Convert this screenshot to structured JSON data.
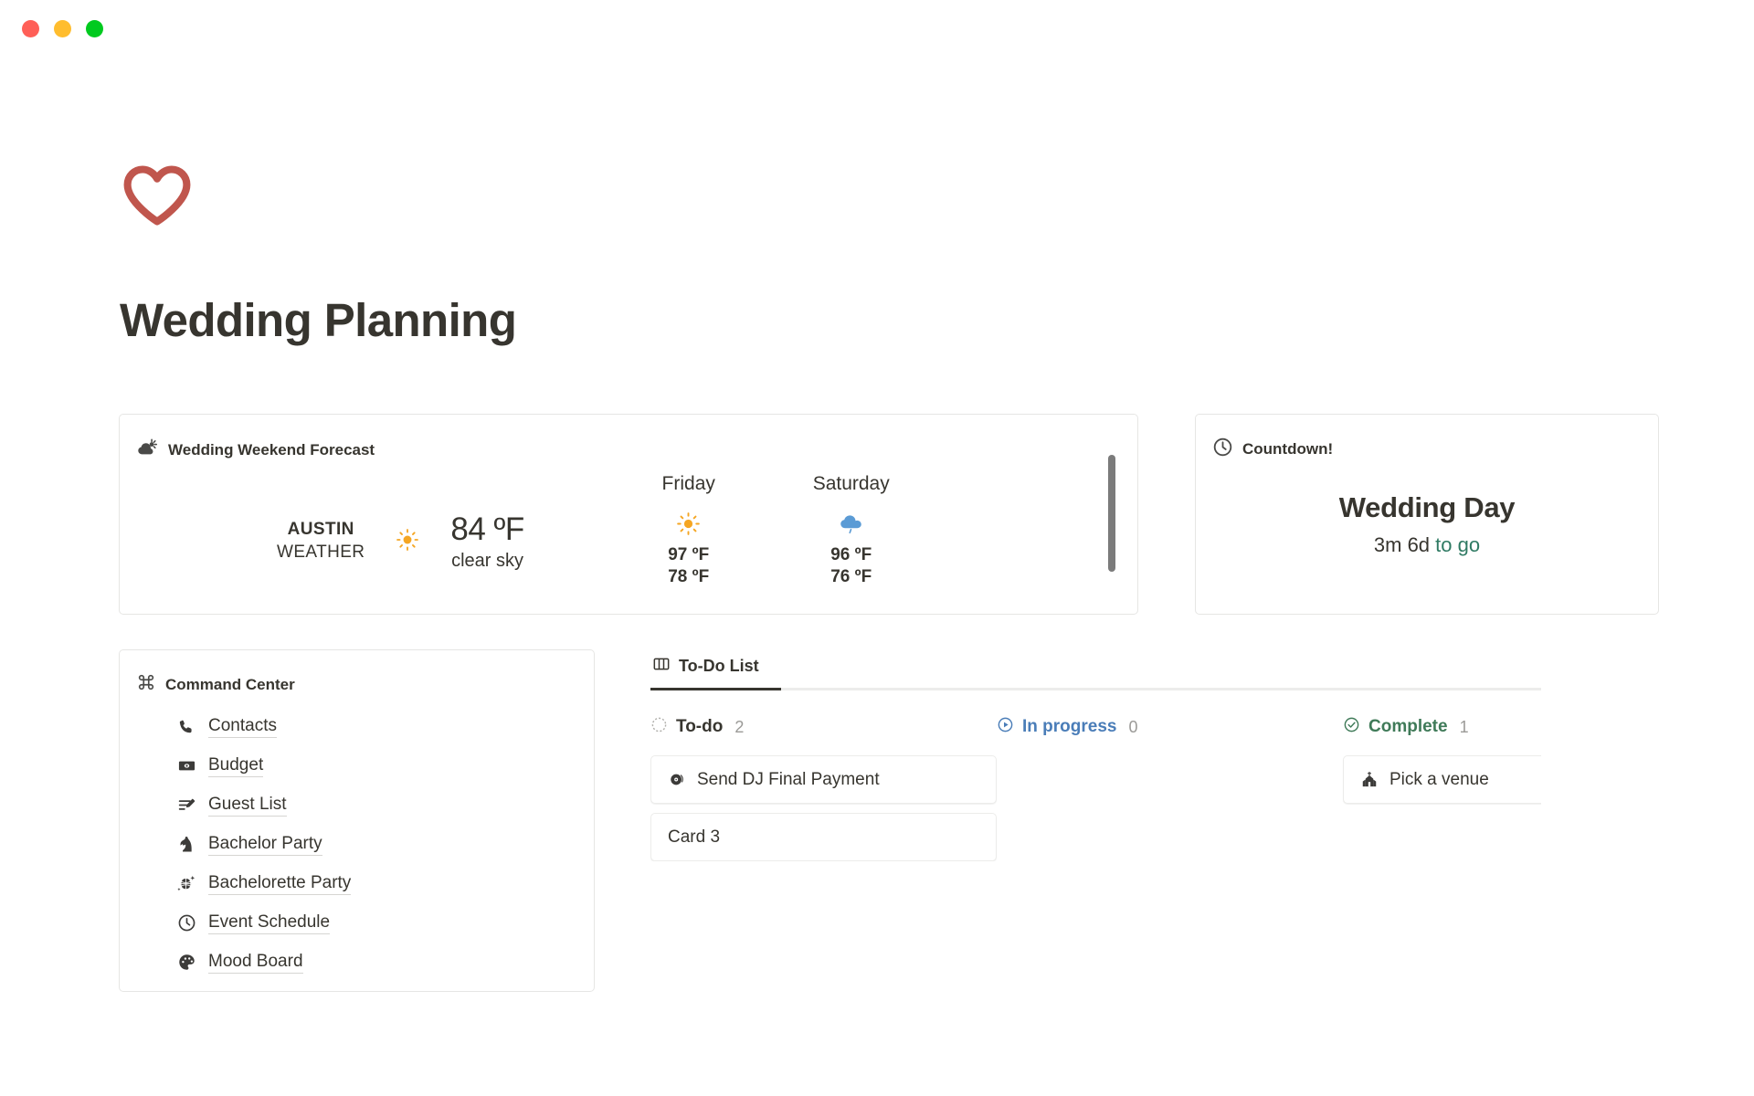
{
  "window": {
    "controls": [
      {
        "name": "close",
        "color": "#ff5f57"
      },
      {
        "name": "minimize",
        "color": "#ffbd2e"
      },
      {
        "name": "zoom",
        "color": "#00ca1f"
      }
    ]
  },
  "page": {
    "icon": "heart-outline-icon",
    "icon_color": "#c0564d",
    "title": "Wedding Planning"
  },
  "weather": {
    "header_icon": "cloud-sun-icon",
    "header_label": "Wedding Weekend Forecast",
    "city": "AUSTIN",
    "city_sub": "WEATHER",
    "current_icon": "sun-icon",
    "current_temp": "84 ºF",
    "current_desc": "clear sky",
    "forecast": [
      {
        "day": "Friday",
        "icon": "sun-icon",
        "high": "97 ºF",
        "low": "78 ºF"
      },
      {
        "day": "Saturday",
        "icon": "rain-cloud-icon",
        "high": "96 ºF",
        "low": "76 ºF"
      }
    ]
  },
  "countdown": {
    "header_icon": "clock-icon",
    "header_label": "Countdown!",
    "event": "Wedding Day",
    "remaining": "3m 6d",
    "suffix": "to go",
    "suffix_color": "#2f7a63"
  },
  "command_center": {
    "header_icon": "command-icon",
    "header_label": "Command Center",
    "items": [
      {
        "icon": "phone-icon",
        "label": "Contacts"
      },
      {
        "icon": "banknote-icon",
        "label": "Budget"
      },
      {
        "icon": "list-edit-icon",
        "label": "Guest List"
      },
      {
        "icon": "chess-knight-icon",
        "label": "Bachelor Party"
      },
      {
        "icon": "disco-ball-icon",
        "label": "Bachelorette Party"
      },
      {
        "icon": "clock-icon",
        "label": "Event Schedule"
      },
      {
        "icon": "palette-icon",
        "label": "Mood Board"
      }
    ]
  },
  "board": {
    "tab_icon": "board-columns-icon",
    "tab_label": "To-Do List",
    "columns": [
      {
        "status_icon": "dashed-circle-icon",
        "name": "To-do",
        "count": "2",
        "color": "#37352f",
        "cards": [
          {
            "icon": "vinyl-record-icon",
            "label": "Send DJ Final Payment"
          },
          {
            "icon": "",
            "label": "Card 3"
          }
        ]
      },
      {
        "status_icon": "play-circle-icon",
        "name": "In progress",
        "count": "0",
        "color": "#4a7db8",
        "cards": []
      },
      {
        "status_icon": "check-circle-icon",
        "name": "Complete",
        "count": "1",
        "color": "#3f7a58",
        "cards": [
          {
            "icon": "church-icon",
            "label": "Pick a venue"
          }
        ]
      }
    ]
  }
}
